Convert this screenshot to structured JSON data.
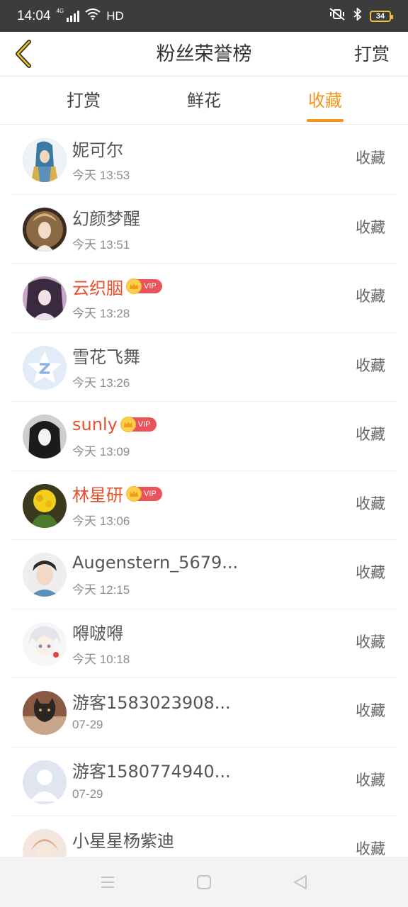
{
  "status_bar": {
    "time": "14:04",
    "network": "4G",
    "hd": "HD",
    "battery": "34"
  },
  "nav": {
    "title": "粉丝荣誉榜",
    "action": "打赏"
  },
  "tabs": [
    {
      "label": "打赏",
      "active": false
    },
    {
      "label": "鲜花",
      "active": false
    },
    {
      "label": "收藏",
      "active": true
    }
  ],
  "vip_label": "VIP",
  "rows": [
    {
      "name": "妮可尔",
      "time": "今天 13:53",
      "action": "收藏",
      "vip": false
    },
    {
      "name": "幻颜梦醒",
      "time": "今天 13:51",
      "action": "收藏",
      "vip": false
    },
    {
      "name": "云织胭",
      "time": "今天 13:28",
      "action": "收藏",
      "vip": true
    },
    {
      "name": "雪花飞舞",
      "time": "今天 13:26",
      "action": "收藏",
      "vip": false
    },
    {
      "name": "sunly",
      "time": "今天 13:09",
      "action": "收藏",
      "vip": true
    },
    {
      "name": "林星研",
      "time": "今天 13:06",
      "action": "收藏",
      "vip": true
    },
    {
      "name": "Augenstern_5679...",
      "time": "今天 12:15",
      "action": "收藏",
      "vip": false
    },
    {
      "name": "嘚啵嘚",
      "time": "今天 10:18",
      "action": "收藏",
      "vip": false
    },
    {
      "name": "游客1583023908...",
      "time": "07-29",
      "action": "收藏",
      "vip": false
    },
    {
      "name": "游客1580774940...",
      "time": "07-29",
      "action": "收藏",
      "vip": false
    },
    {
      "name": "小星星杨紫迪",
      "time": "",
      "action": "收藏",
      "vip": false
    }
  ],
  "colors": {
    "accent": "#f3961a",
    "vip_name": "#e8502c",
    "vip_badge": "#e9545a"
  }
}
